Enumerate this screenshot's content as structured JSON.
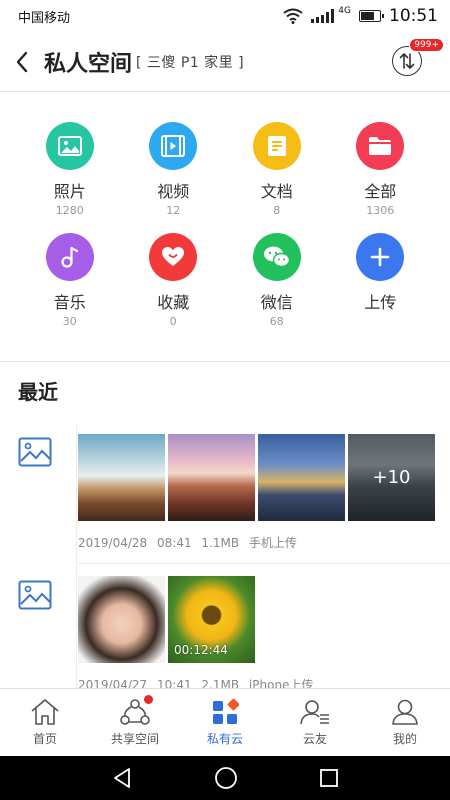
{
  "status_bar": {
    "carrier": "中国移动",
    "network": "4G",
    "time": "10:51"
  },
  "header": {
    "title": "私人空间",
    "subtitle": "[ 三傻 P1 家里 ]",
    "transfer_badge": "999+"
  },
  "categories": [
    {
      "label": "照片",
      "count": "1280",
      "color": "#26c6a0",
      "icon": "photo-icon"
    },
    {
      "label": "视频",
      "count": "12",
      "color": "#2ea9f0",
      "icon": "video-icon"
    },
    {
      "label": "文档",
      "count": "8",
      "color": "#f6bd16",
      "icon": "document-icon"
    },
    {
      "label": "全部",
      "count": "1306",
      "color": "#f23d55",
      "icon": "folder-icon"
    },
    {
      "label": "音乐",
      "count": "30",
      "color": "#a65ee8",
      "icon": "music-icon"
    },
    {
      "label": "收藏",
      "count": "0",
      "color": "#f23a3a",
      "icon": "heart-icon"
    },
    {
      "label": "微信",
      "count": "68",
      "color": "#22c15e",
      "icon": "wechat-icon"
    },
    {
      "label": "上传",
      "count": "",
      "color": "#3b78f0",
      "icon": "plus-icon"
    }
  ],
  "recent": {
    "title": "最近",
    "groups": [
      {
        "date": "2019/04/28",
        "time": "08:41",
        "size": "1.1MB",
        "source": "手机上传",
        "more": "+10"
      },
      {
        "date": "2019/04/27",
        "time": "10:41",
        "size": "2.1MB",
        "source": "iPhone上传",
        "duration": "00:12:44"
      }
    ]
  },
  "nav": [
    {
      "label": "首页",
      "icon": "home-icon"
    },
    {
      "label": "共享空间",
      "icon": "share-icon"
    },
    {
      "label": "私有云",
      "icon": "cloud-grid-icon"
    },
    {
      "label": "云友",
      "icon": "friends-icon"
    },
    {
      "label": "我的",
      "icon": "profile-icon"
    }
  ],
  "colors": {
    "accent": "#2f6ed9",
    "badge": "#e5262b"
  }
}
